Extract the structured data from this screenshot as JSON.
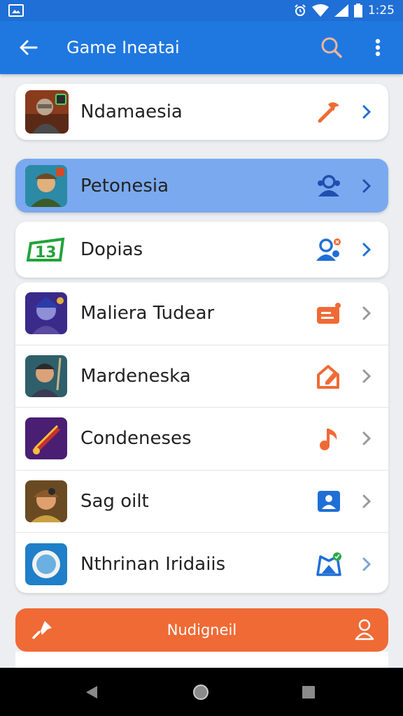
{
  "status_bar": {
    "time": "1:25"
  },
  "app_bar": {
    "title": "Game Ineatai"
  },
  "items": [
    {
      "label": "Ndamaesia",
      "action_icon": "tool-icon"
    },
    {
      "label": "Petonesia",
      "action_icon": "people-icon",
      "selected": true
    },
    {
      "label": "Dopias",
      "action_icon": "people-alert-icon"
    },
    {
      "label": "Maliera Tudear",
      "action_icon": "card-icon"
    },
    {
      "label": "Mardeneska",
      "action_icon": "edit-home-icon"
    },
    {
      "label": "Condeneses",
      "action_icon": "music-note-icon"
    },
    {
      "label": "Sag oilt",
      "action_icon": "contact-icon"
    },
    {
      "label": "Nthrinan Iridaiis",
      "action_icon": "map-check-icon"
    }
  ],
  "bottom_button": {
    "label": "Nudigneil"
  },
  "colors": {
    "primary": "#1f78e0",
    "status": "#1f6fd6",
    "accent": "#f06a35",
    "selected": "#7aa9ef"
  }
}
